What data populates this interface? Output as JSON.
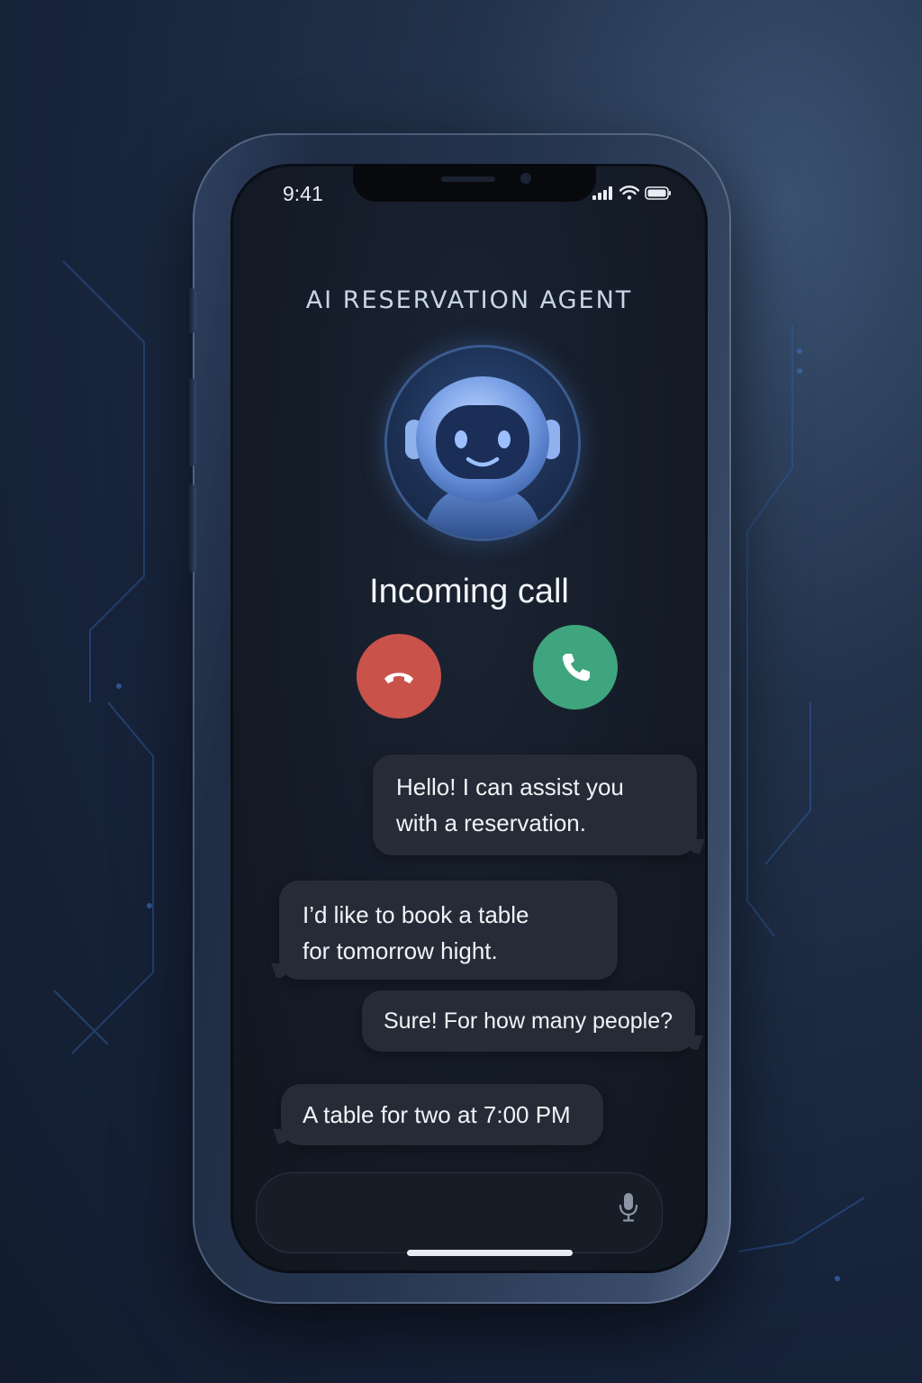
{
  "status_bar": {
    "time": "9:41",
    "icons": [
      "signal-icon",
      "wifi-icon",
      "battery-icon"
    ]
  },
  "app": {
    "title": "AI RESERVATION AGENT"
  },
  "call": {
    "status": "Incoming call",
    "decline_icon": "phone-hangup-icon",
    "accept_icon": "phone-icon",
    "decline_color": "#c9524a",
    "accept_color": "#3fa57e"
  },
  "conversation": {
    "messages": [
      {
        "from": "agent",
        "lines": [
          "Hello! I can assist you",
          "with a reservation."
        ]
      },
      {
        "from": "user",
        "lines": [
          "I’d like to book a table",
          "for tomorrow hight."
        ]
      },
      {
        "from": "agent",
        "lines": [
          "Sure! For how many people?"
        ]
      },
      {
        "from": "user",
        "lines": [
          "A table for two at 7:00 PM"
        ]
      }
    ]
  },
  "input": {
    "icon": "microphone-icon"
  },
  "colors": {
    "accent": "#4f7fd0",
    "bubble": "#252c37",
    "screen": "#141b27"
  }
}
